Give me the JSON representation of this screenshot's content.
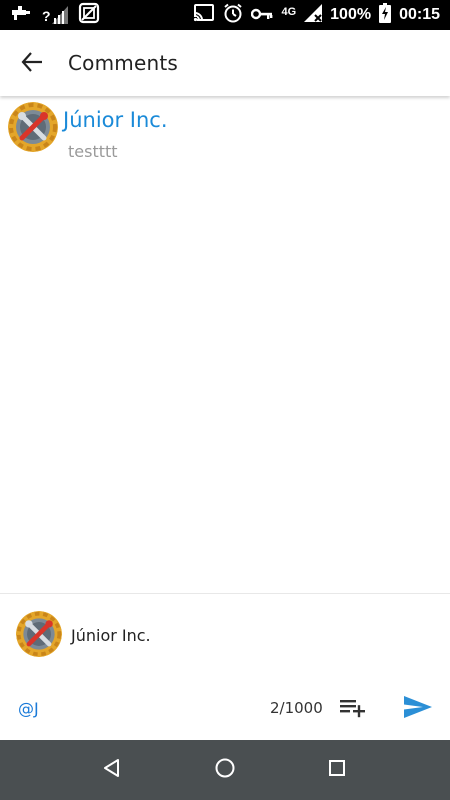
{
  "status_bar": {
    "network_type": "4G",
    "battery_percent": "100%",
    "time": "00:15",
    "unknown_signal": "?",
    "icons": [
      "debug-icon",
      "unknown-signal-icon",
      "no-sim-icon",
      "vpn-badge-icon",
      "cast-icon",
      "alarm-icon",
      "key-icon",
      "signal-icon",
      "battery-charging-icon"
    ]
  },
  "app_bar": {
    "title": "Comments",
    "back_icon": "arrow-back-icon"
  },
  "comments": [
    {
      "author": "Júnior Inc.",
      "text": "testttt",
      "avatar_icon": "wrench-gear-avatar"
    }
  ],
  "mention_suggestion": {
    "name": "Júnior Inc.",
    "avatar_icon": "wrench-gear-avatar"
  },
  "composer": {
    "value": "@J",
    "counter": "2/1000",
    "list_add_icon": "playlist-add-icon",
    "send_icon": "send-icon"
  },
  "nav_bar": {
    "icons": [
      "back-triangle-icon",
      "home-circle-icon",
      "recents-square-icon"
    ]
  },
  "colors": {
    "accent": "#1a8ad8",
    "send": "#2b8fd6",
    "status_bar": "#000000",
    "nav_bar": "#4a4f51",
    "muted_text": "#9a9a9a"
  }
}
